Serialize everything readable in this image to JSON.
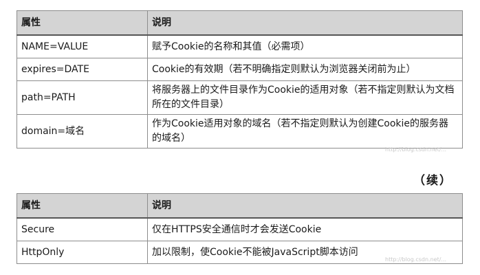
{
  "table1": {
    "headers": [
      "属性",
      "说明"
    ],
    "rows": [
      [
        "NAME=VALUE",
        "赋予Cookie的名称和其值（必需项）"
      ],
      [
        "expires=DATE",
        "Cookie的有效期（若不明确指定则默认为浏览器关闭前为止）"
      ],
      [
        "path=PATH",
        "将服务器上的文件目录作为Cookie的适用对象（若不指定则默认为文档所在的文件目录）"
      ],
      [
        "domain=域名",
        "作为Cookie适用对象的域名（若不指定则默认为创建Cookie的服务器的域名）"
      ]
    ]
  },
  "continued_label": "（续）",
  "table2": {
    "headers": [
      "属性",
      "说明"
    ],
    "rows": [
      [
        "Secure",
        "仅在HTTPS安全通信时才会发送Cookie"
      ],
      [
        "HttpOnly",
        "加以限制，使Cookie不能被JavaScript脚本访问"
      ]
    ]
  },
  "watermarks": [
    "http://blog.csdn.net/...",
    "http://blog.csdn.net/..."
  ]
}
